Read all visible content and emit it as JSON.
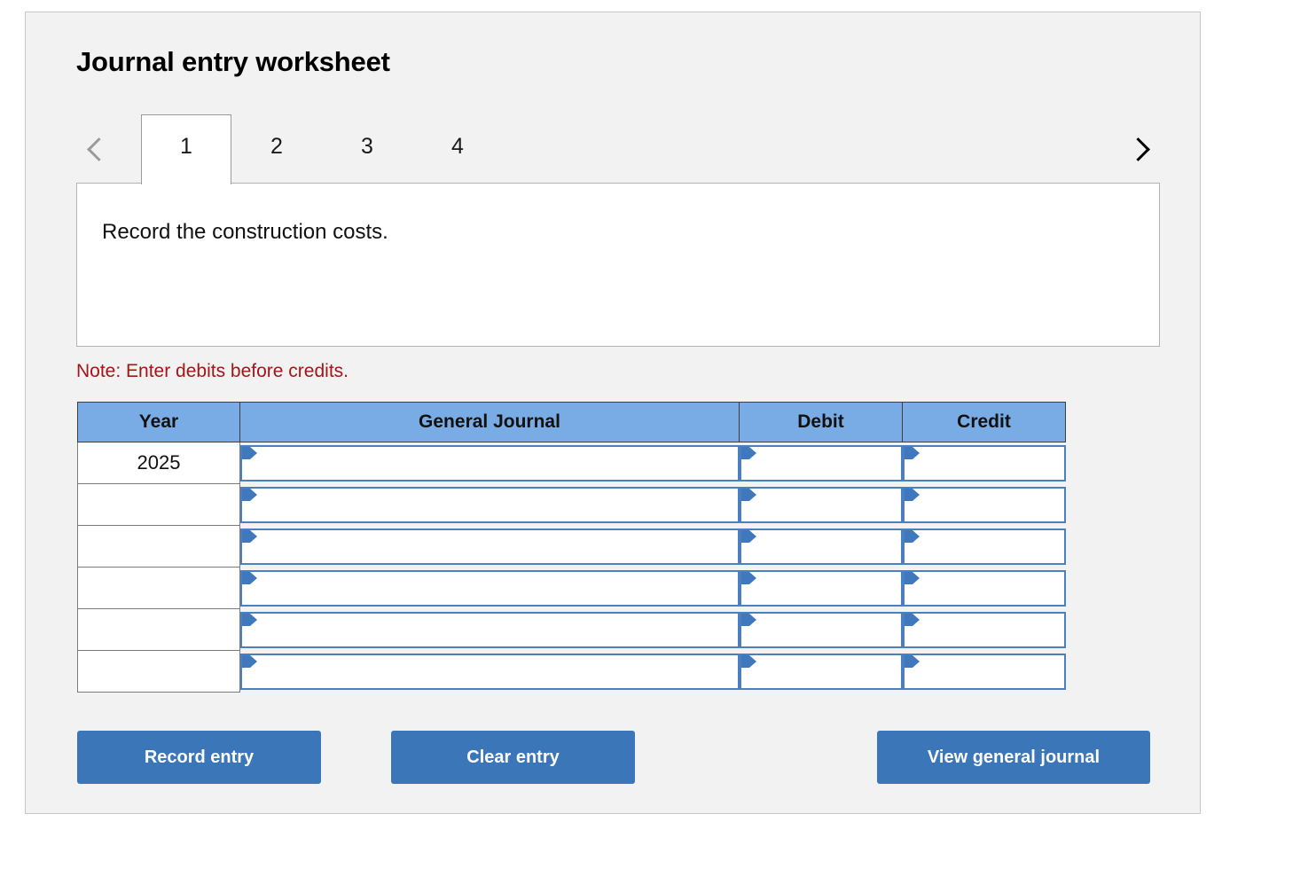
{
  "panel": {
    "title": "Journal entry worksheet"
  },
  "pager": {
    "prev_icon": "chevron-left-icon",
    "next_icon": "chevron-right-icon",
    "tabs": [
      {
        "label": "1",
        "active": true
      },
      {
        "label": "2",
        "active": false
      },
      {
        "label": "3",
        "active": false
      },
      {
        "label": "4",
        "active": false
      }
    ]
  },
  "description": {
    "text": "Record the construction costs."
  },
  "note": {
    "text": "Note: Enter debits before credits."
  },
  "table": {
    "headers": [
      "Year",
      "General Journal",
      "Debit",
      "Credit"
    ],
    "rows": [
      {
        "year": "2025",
        "general_journal": "",
        "debit": "",
        "credit": ""
      },
      {
        "year": "",
        "general_journal": "",
        "debit": "",
        "credit": ""
      },
      {
        "year": "",
        "general_journal": "",
        "debit": "",
        "credit": ""
      },
      {
        "year": "",
        "general_journal": "",
        "debit": "",
        "credit": ""
      },
      {
        "year": "",
        "general_journal": "",
        "debit": "",
        "credit": ""
      },
      {
        "year": "",
        "general_journal": "",
        "debit": "",
        "credit": ""
      }
    ]
  },
  "actions": {
    "record_entry": "Record entry",
    "clear_entry": "Clear entry",
    "view_general_journal": "View general journal"
  },
  "colors": {
    "panel_background": "#f2f2f2",
    "header_blue": "#79ace5",
    "button_blue": "#3a76b8",
    "input_border_blue": "#4a7fc1",
    "note_red": "#a31616"
  }
}
